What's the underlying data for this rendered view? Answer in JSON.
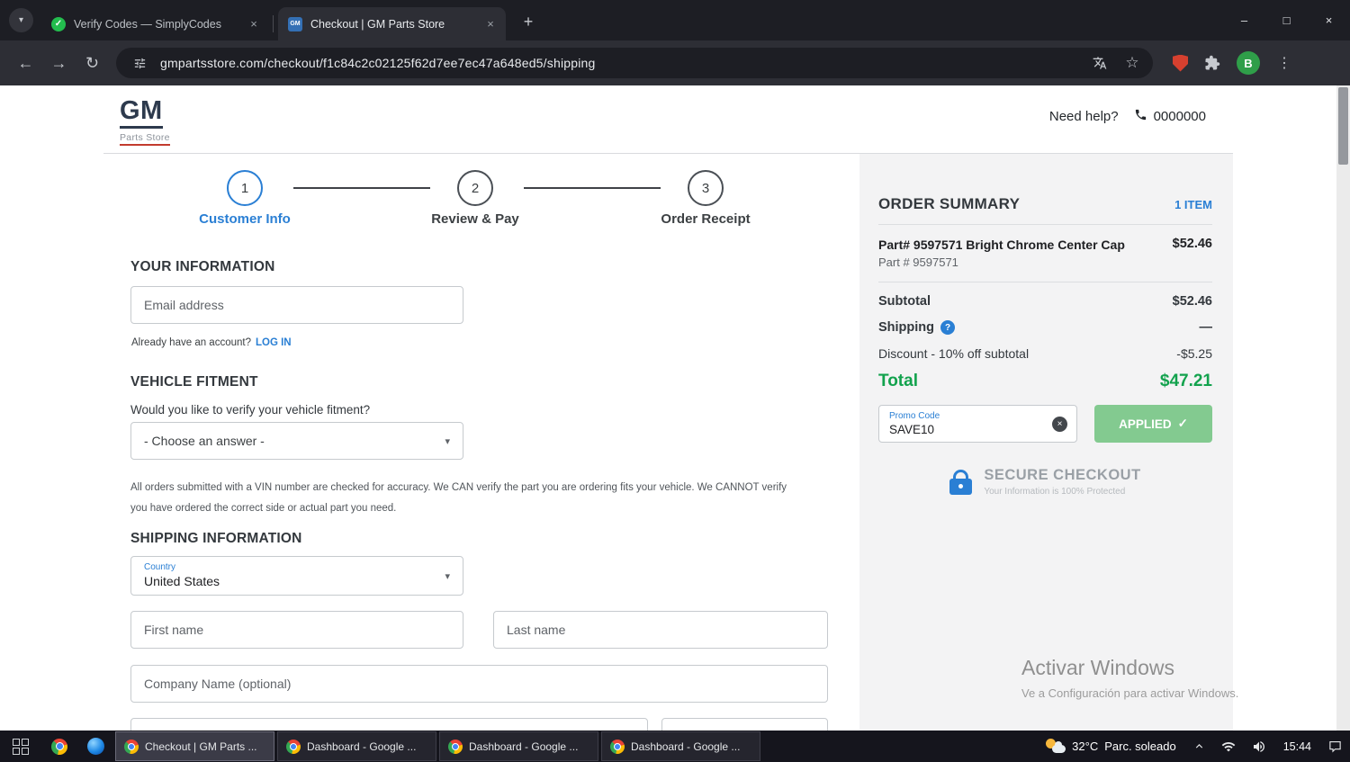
{
  "browser": {
    "tabs": [
      {
        "title": "Verify Codes — SimplyCodes",
        "favicon": "✓"
      },
      {
        "title": "Checkout | GM Parts Store",
        "favicon": "GM"
      }
    ],
    "url": "gmpartsstore.com/checkout/f1c84c2c02125f62d7ee7ec47a648ed5/shipping",
    "profile_initial": "B"
  },
  "icons": {
    "back": "←",
    "forward": "→",
    "reload": "↻",
    "new_tab": "+",
    "close_tab": "×",
    "minimize": "–",
    "maximize": "□",
    "close_window": "×",
    "menu": "⋮",
    "bookmark_star": "☆",
    "chevron_down": "▾",
    "check": "✓",
    "clear": "×",
    "question": "?"
  },
  "page": {
    "logo": {
      "gm": "GM",
      "sub": "Parts Store"
    },
    "need_help": "Need help?",
    "phone": "0000000",
    "steps": [
      {
        "number": "1",
        "label": "Customer Info"
      },
      {
        "number": "2",
        "label": "Review & Pay"
      },
      {
        "number": "3",
        "label": "Order Receipt"
      }
    ],
    "your_information": {
      "title": "YOUR INFORMATION",
      "email_placeholder": "Email address",
      "account_question": "Already have an account?",
      "login_link": "LOG IN"
    },
    "vehicle_fitment": {
      "title": "VEHICLE FITMENT",
      "question": "Would you like to verify your vehicle fitment?",
      "select_value": "- Choose an answer -",
      "disclaimer": "All orders submitted with a VIN number are checked for accuracy. We CAN verify the part you are ordering fits your vehicle. We CANNOT verify you have ordered the correct side or actual part you need."
    },
    "shipping_information": {
      "title": "SHIPPING INFORMATION",
      "country_label": "Country",
      "country_value": "United States",
      "first_name_placeholder": "First name",
      "last_name_placeholder": "Last name",
      "company_placeholder": "Company Name (optional)"
    }
  },
  "summary": {
    "title": "ORDER SUMMARY",
    "item_count": "1 ITEM",
    "product": {
      "name": "Part# 9597571 Bright Chrome Center Cap",
      "price": "$52.46",
      "part_number": "Part # 9597571"
    },
    "subtotal_label": "Subtotal",
    "subtotal_value": "$52.46",
    "shipping_label": "Shipping",
    "shipping_value": "—",
    "discount_label": "Discount - 10% off subtotal",
    "discount_value": "-$5.25",
    "total_label": "Total",
    "total_value": "$47.21",
    "promo": {
      "label": "Promo Code",
      "value": "SAVE10"
    },
    "applied_label": "APPLIED",
    "secure": {
      "title": "SECURE CHECKOUT",
      "subtitle": "Your Information is 100% Protected"
    }
  },
  "watermark": {
    "line1": "Activar Windows",
    "line2": "Ve a Configuración para activar Windows."
  },
  "taskbar": {
    "apps": [
      {
        "label": "Checkout | GM Parts ..."
      },
      {
        "label": "Dashboard - Google ..."
      },
      {
        "label": "Dashboard - Google ..."
      },
      {
        "label": "Dashboard - Google ..."
      }
    ],
    "temperature": "32°C",
    "weather": "Parc. soleado",
    "time": "15:44"
  }
}
